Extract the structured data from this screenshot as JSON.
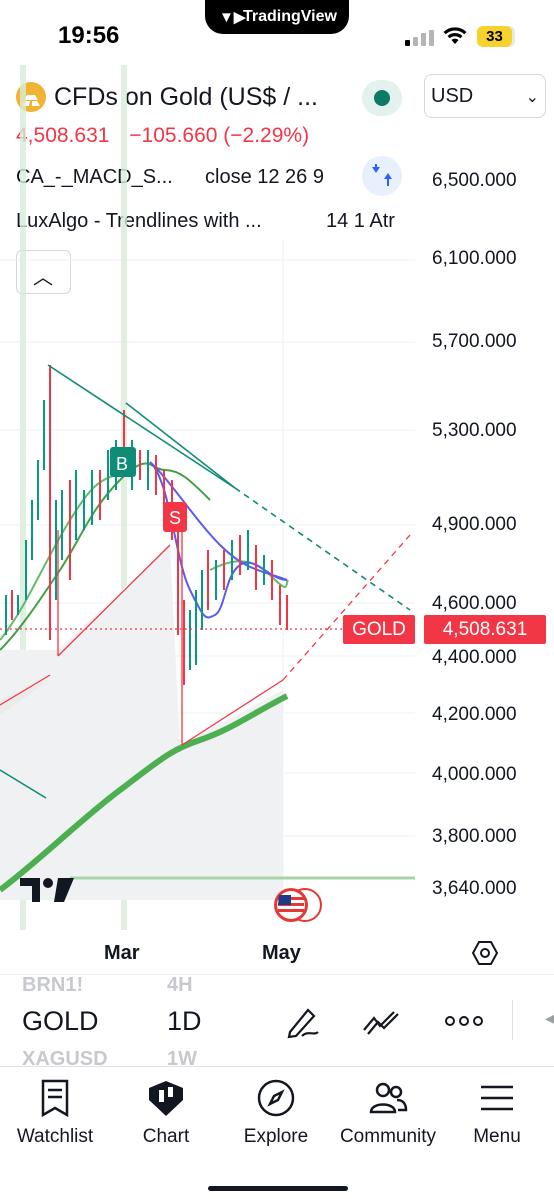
{
  "status_bar": {
    "time": "19:56",
    "island_app": "TradingView",
    "battery": "33"
  },
  "header": {
    "symbol_title": "CFDs on Gold (US$ / ...",
    "currency": "USD",
    "price": "4,508.631",
    "change": "−105.660 (−2.29%)"
  },
  "indicators": [
    {
      "name": "CA_-_MACD_S...",
      "params": "close 12 26 9"
    },
    {
      "name": "LuxAlgo - Trendlines with ...",
      "params": "14 1 Atr"
    }
  ],
  "price_axis": {
    "labels": [
      "6,500.000",
      "6,100.000",
      "5,700.000",
      "5,300.000",
      "4,900.000",
      "4,600.000",
      "4,400.000",
      "4,200.000",
      "4,000.000",
      "3,800.000",
      "3,640.000"
    ],
    "symbol_tag": "GOLD",
    "last_price_tag": "4,508.631"
  },
  "chart_markers": {
    "buy": "B",
    "sell": "S"
  },
  "time_axis": [
    "Mar",
    "May"
  ],
  "toolbar": {
    "symbol_prev": "BRN1!",
    "symbol": "GOLD",
    "symbol_next": "XAGUSD",
    "interval_prev": "4H",
    "interval": "1D",
    "interval_next": "1W"
  },
  "tabs": [
    {
      "label": "Watchlist",
      "icon": "watchlist-icon"
    },
    {
      "label": "Chart",
      "icon": "chart-icon"
    },
    {
      "label": "Explore",
      "icon": "compass-icon"
    },
    {
      "label": "Community",
      "icon": "community-icon"
    },
    {
      "label": "Menu",
      "icon": "menu-icon"
    }
  ],
  "colors": {
    "down": "#f23645",
    "up": "#089981",
    "trendline": "#0e8c77",
    "ma_long": "#4caf50",
    "signal_line": "#5b5bf0",
    "accent_blue": "#2962ff"
  }
}
